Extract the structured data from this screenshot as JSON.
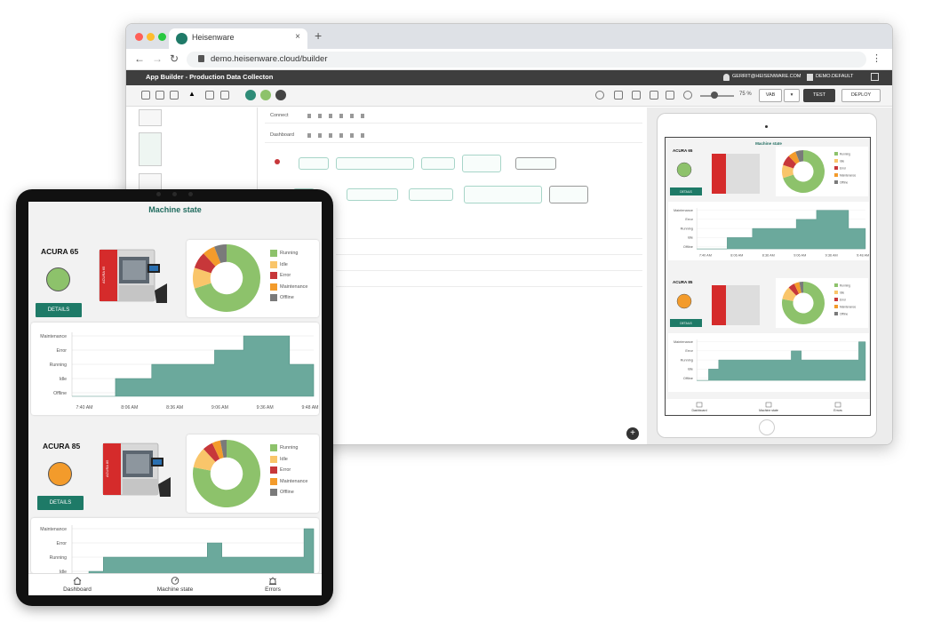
{
  "browser": {
    "tab_title": "Heisenware",
    "url": "demo.heisenware.cloud/builder",
    "new_tab": "+",
    "close": "×",
    "menu": "⋮"
  },
  "app_header": {
    "title": "App Builder - Production Data Collecton",
    "user": "GERRIT@HEISENWARE.COM",
    "domain": "DEMO.DEFAULT"
  },
  "toolbar": {
    "zoom": "75 %",
    "breakpoint": "VAB",
    "test": "TEST",
    "deploy": "DEPLOY"
  },
  "flow": {
    "rows": [
      "Connect",
      "Dashboard"
    ]
  },
  "machine_state": {
    "title": "Machine state",
    "details_label": "DETAILS",
    "machines": [
      {
        "name": "ACURA 65",
        "status_color": "#8dc26b",
        "machine_label": "ACURA 65"
      },
      {
        "name": "ACURA 85",
        "status_color": "#f39b2b",
        "machine_label": "ACURA 85"
      }
    ],
    "legend": [
      {
        "label": "Running",
        "color": "#8dc26b"
      },
      {
        "label": "Idle",
        "color": "#f9c56a"
      },
      {
        "label": "Error",
        "color": "#c7373a"
      },
      {
        "label": "Maintenance",
        "color": "#f39b2b"
      },
      {
        "label": "Offline",
        "color": "#7a7a7a"
      }
    ],
    "state_levels": [
      "Maintenance",
      "Error",
      "Running",
      "Idle",
      "Offline"
    ]
  },
  "chart_data": [
    {
      "type": "pie",
      "title": "",
      "categories": [
        "Running",
        "Idle",
        "Error",
        "Maintenance",
        "Offline"
      ],
      "values": [
        70,
        10,
        8,
        6,
        6
      ]
    },
    {
      "type": "line",
      "title": "",
      "xlabel": "",
      "ylabel": "",
      "x": [
        "7:40 AM",
        "8:06 AM",
        "8:36 AM",
        "9:06 AM",
        "9:36 AM",
        "9:48 AM"
      ],
      "y_levels": [
        "Offline",
        "Idle",
        "Running",
        "Error",
        "Maintenance"
      ],
      "steps": [
        {
          "t": 0.0,
          "level": 0
        },
        {
          "t": 0.18,
          "level": 1
        },
        {
          "t": 0.33,
          "level": 2
        },
        {
          "t": 0.59,
          "level": 3
        },
        {
          "t": 0.71,
          "level": 4
        },
        {
          "t": 0.9,
          "level": 2
        }
      ]
    },
    {
      "type": "pie",
      "title": "",
      "categories": [
        "Running",
        "Idle",
        "Error",
        "Maintenance",
        "Offline"
      ],
      "values": [
        78,
        10,
        5,
        4,
        3
      ]
    },
    {
      "type": "line",
      "title": "",
      "xlabel": "",
      "ylabel": "",
      "y_levels": [
        "Offline",
        "Idle",
        "Running",
        "Error",
        "Maintenance"
      ],
      "steps": [
        {
          "t": 0.0,
          "level": 0
        },
        {
          "t": 0.07,
          "level": 1
        },
        {
          "t": 0.13,
          "level": 2
        },
        {
          "t": 0.56,
          "level": 3
        },
        {
          "t": 0.62,
          "level": 2
        },
        {
          "t": 0.96,
          "level": 4
        }
      ]
    }
  ],
  "nav": {
    "items": [
      {
        "label": "Dashboard",
        "icon": "home-icon"
      },
      {
        "label": "Machine state",
        "icon": "gauge-icon"
      },
      {
        "label": "Errors",
        "icon": "alert-icon"
      }
    ]
  }
}
